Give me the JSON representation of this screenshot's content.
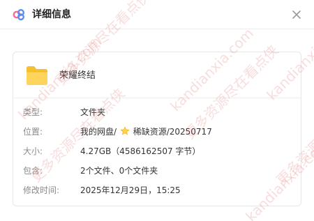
{
  "header": {
    "title": "详细信息",
    "icons": {
      "app": "file-info-icon",
      "close": "close-icon"
    }
  },
  "file": {
    "name": "荣耀终结",
    "icon": "folder-icon",
    "rows": [
      {
        "label": "类型:",
        "value": "文件夹"
      },
      {
        "label": "位置:",
        "value_prefix": "我的网盘/",
        "value_suffix": "稀缺资源/20250717",
        "icon": "star-icon"
      },
      {
        "label": "大小:",
        "value": "4.27GB（4586162507 字节）"
      },
      {
        "label": "包含:",
        "value": "2个文件、0个文件夹"
      },
      {
        "label": "修改时间:",
        "value": "2025年12月29日，15:25"
      }
    ]
  },
  "watermark": {
    "site": "kandianxia.com",
    "text": "更多资源尽在看点侠"
  },
  "colors": {
    "brand_pink": "#f46c9a",
    "brand_blue": "#5b8def",
    "folder": "#f8c542",
    "watermark": "#e16262"
  }
}
